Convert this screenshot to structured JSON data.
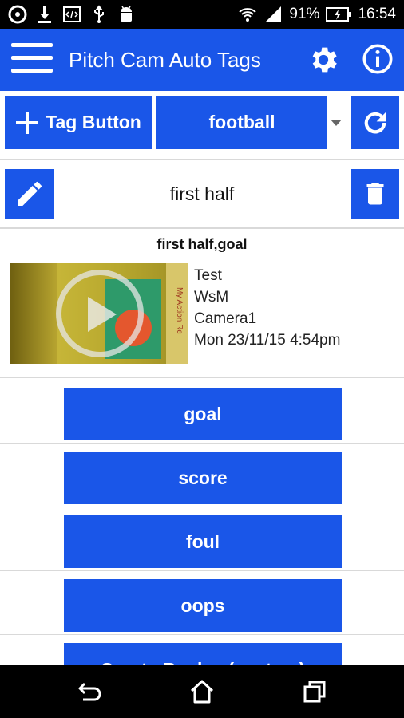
{
  "status_bar": {
    "icons_left": [
      "circle-app-icon",
      "download-icon",
      "code-icon",
      "usb-icon",
      "android-icon"
    ],
    "wifi_icon": "wifi-icon",
    "signal_icon": "signal-icon",
    "battery_percent": "91%",
    "battery_icon": "battery-charging-icon",
    "time": "16:54"
  },
  "app_bar": {
    "title": "Pitch Cam Auto Tags",
    "menu_icon": "hamburger-menu-icon",
    "settings_icon": "gear-icon",
    "info_icon": "info-icon"
  },
  "toolbar": {
    "tag_button_label": "Tag Button",
    "sport_selected": "football",
    "refresh_icon": "refresh-icon"
  },
  "session": {
    "name": "first half",
    "edit_icon": "pencil-icon",
    "delete_icon": "trash-icon"
  },
  "clip": {
    "title": "first half,goal",
    "thumbnail_watermark": "My Action Re",
    "meta": [
      "Test",
      "WsM",
      "Camera1",
      "Mon 23/11/15 4:54pm"
    ]
  },
  "tags": [
    "goal",
    "score",
    "foul",
    "oops",
    "Create Replay (custom)"
  ],
  "colors": {
    "primary": "#1a56e8",
    "status_bar": "#000000",
    "divider": "#d9d9d9"
  },
  "nav_bar": {
    "back_icon": "back-icon",
    "home_icon": "home-icon",
    "recents_icon": "recents-icon"
  }
}
